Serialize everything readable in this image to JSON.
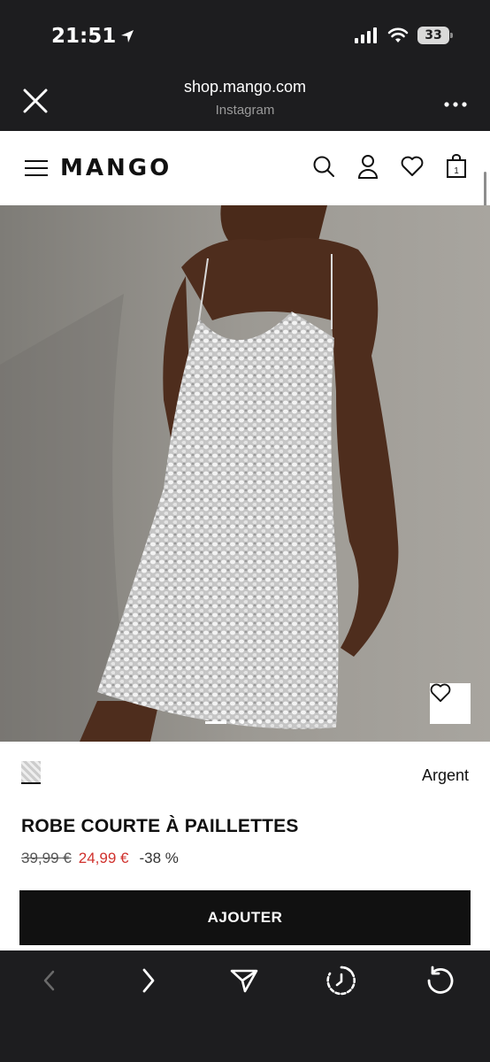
{
  "status_bar": {
    "time": "21:51",
    "battery": "33"
  },
  "browser": {
    "url": "shop.mango.com",
    "source": "Instagram"
  },
  "nav": {
    "logo": "MANGO",
    "cart_count": "1"
  },
  "product": {
    "color_name": "Argent",
    "title": "ROBE COURTE À PAILLETTES",
    "old_price": "39,99 €",
    "new_price": "24,99 €",
    "discount": "-38 %",
    "add_button": "AJOUTER"
  },
  "icons": {
    "close": "close-icon",
    "more": "more-icon",
    "menu": "hamburger-icon",
    "search": "search-icon",
    "account": "user-icon",
    "wishlist": "heart-icon",
    "cart": "shopping-bag-icon",
    "back": "chevron-left-icon",
    "forward": "chevron-right-icon",
    "share": "share-icon",
    "history": "history-icon",
    "reload": "reload-icon"
  },
  "colors": {
    "accent_price": "#d0312d",
    "button": "#111111",
    "chrome": "#1d1d1f"
  }
}
